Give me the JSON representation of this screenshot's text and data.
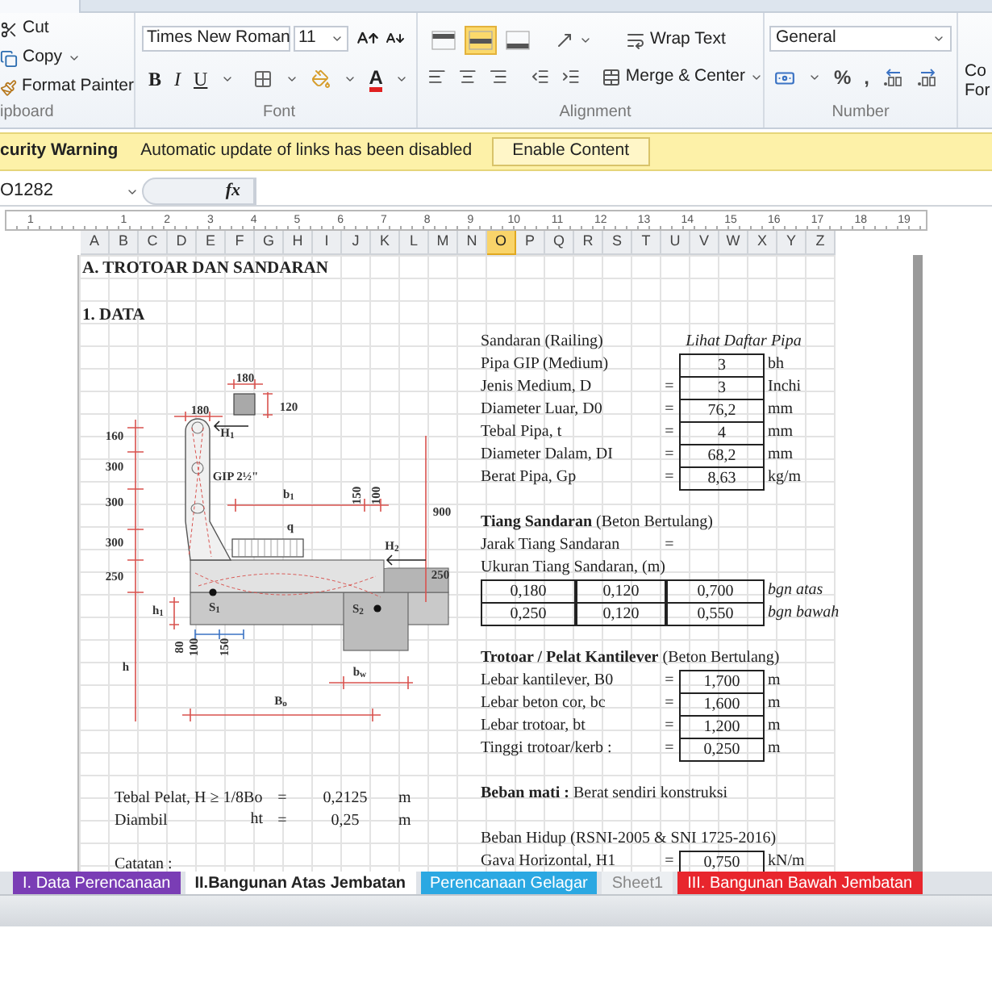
{
  "ribbon": {
    "clipboard": {
      "items": [
        {
          "kind": "cut",
          "label": "Cut"
        },
        {
          "kind": "copy",
          "label": "Copy"
        },
        {
          "kind": "painter",
          "label": "Format Painter"
        }
      ],
      "group_label": "ipboard"
    },
    "font": {
      "family": "Times New Roman",
      "size": "11",
      "styles": [
        "B",
        "I",
        "U"
      ],
      "color_letter": "A",
      "group_label": "Font"
    },
    "alignment": {
      "vertical": [
        {
          "kind": "top",
          "selected": false
        },
        {
          "kind": "middle",
          "selected": true
        },
        {
          "kind": "bottom",
          "selected": false
        }
      ],
      "wrap": "Wrap Text",
      "merge": "Merge & Center",
      "group_label": "Alignment"
    },
    "number": {
      "format": "General",
      "symbols": [
        "%",
        ","
      ],
      "group_label": "Number"
    },
    "styles_cut": [
      "Co",
      "For"
    ]
  },
  "security_bar": {
    "title": "curity Warning",
    "message": "Automatic update of links has been disabled",
    "button": "Enable Content"
  },
  "formula_bar": {
    "name_box": "O1282",
    "fx": "fx"
  },
  "ruler": [
    "1",
    "1",
    "2",
    "3",
    "4",
    "5",
    "6",
    "7",
    "8",
    "9",
    "10",
    "11",
    "12",
    "13",
    "14",
    "15",
    "16",
    "17",
    "18",
    "19"
  ],
  "columns": [
    {
      "label": "A",
      "selected": false
    },
    {
      "label": "B",
      "selected": false
    },
    {
      "label": "C",
      "selected": false
    },
    {
      "label": "D",
      "selected": false
    },
    {
      "label": "E",
      "selected": false
    },
    {
      "label": "F",
      "selected": false
    },
    {
      "label": "G",
      "selected": false
    },
    {
      "label": "H",
      "selected": false
    },
    {
      "label": "I",
      "selected": false
    },
    {
      "label": "J",
      "selected": false
    },
    {
      "label": "K",
      "selected": false
    },
    {
      "label": "L",
      "selected": false
    },
    {
      "label": "M",
      "selected": false
    },
    {
      "label": "N",
      "selected": false
    },
    {
      "label": "O",
      "selected": true
    },
    {
      "label": "P",
      "selected": false
    },
    {
      "label": "Q",
      "selected": false
    },
    {
      "label": "R",
      "selected": false
    },
    {
      "label": "S",
      "selected": false
    },
    {
      "label": "T",
      "selected": false
    },
    {
      "label": "U",
      "selected": false
    },
    {
      "label": "V",
      "selected": false
    },
    {
      "label": "W",
      "selected": false
    },
    {
      "label": "X",
      "selected": false
    },
    {
      "label": "Y",
      "selected": false
    },
    {
      "label": "Z",
      "selected": false
    }
  ],
  "sheet": {
    "title": "A. TROTOAR DAN SANDARAN",
    "section": "1. DATA",
    "drawing": {
      "labels": [
        "180",
        "120",
        "180",
        "H$_{1}$",
        "160",
        "300",
        "300",
        "300",
        "250",
        "GIP 2½\"",
        "b$_{1}$",
        "150",
        "100",
        "900",
        "q",
        "H$_{2}$",
        "250",
        "h$_{1}$",
        "S$_{1}$",
        "S$_{2}$",
        "80",
        "100",
        "150",
        "b$_{w}$",
        "B$_{o}$",
        "h"
      ]
    },
    "left_rows": [
      {
        "label": "Tebal Pelat, H ≥ 1/8Bo",
        "equals": "=",
        "value": "0,2125",
        "unit": "m"
      },
      {
        "label": "Diambil",
        "symbol": "ht",
        "equals": "=",
        "value": "0,25",
        "unit": "m"
      }
    ],
    "note": "Catatan :",
    "right_sections": [
      {
        "rows": [
          {
            "kind": "heading",
            "label": "Sandaran (Railing)",
            "note": "Lihat Daftar Pipa"
          },
          {
            "kind": "value",
            "label": "Pipa GIP (Medium)",
            "value": "3",
            "unit": "bh"
          },
          {
            "kind": "value",
            "label": "Jenis Medium, D",
            "equals": "=",
            "value": "3",
            "unit": "Inchi"
          },
          {
            "kind": "value",
            "label": "Diameter Luar, D0",
            "equals": "=",
            "value": "76,2",
            "unit": "mm"
          },
          {
            "kind": "value",
            "label": "Tebal Pipa, t",
            "equals": "=",
            "value": "4",
            "unit": "mm"
          },
          {
            "kind": "value",
            "label": "Diameter Dalam, DI",
            "equals": "=",
            "value": "68,2",
            "unit": "mm"
          },
          {
            "kind": "value",
            "label": "Berat Pipa, Gp",
            "equals": "=",
            "value": "8,63",
            "unit": "kg/m"
          }
        ]
      },
      {
        "rows": [
          {
            "kind": "text",
            "text": "**Tiang Sandaran** (Beton Bertulang)"
          },
          {
            "kind": "value",
            "label": "Jarak Tiang Sandaran",
            "equals": "="
          },
          {
            "kind": "text",
            "text": "Ukuran Tiang Sandaran, (m)"
          },
          {
            "kind": "sizes",
            "cells": [
              "0,180",
              "0,120",
              "0,700"
            ],
            "note": "bgn atas"
          },
          {
            "kind": "sizes",
            "cells": [
              "0,250",
              "0,120",
              "0,550"
            ],
            "note": "bgn bawah"
          }
        ]
      },
      {
        "rows": [
          {
            "kind": "text",
            "text": "**Trotoar / Pelat Kantilever** (Beton Bertulang)"
          },
          {
            "kind": "value",
            "label": "Lebar kantilever, B0",
            "equals": "=",
            "value": "1,700",
            "unit": "m"
          },
          {
            "kind": "value",
            "label": "Lebar beton cor, bc",
            "equals": "=",
            "value": "1,600",
            "unit": "m"
          },
          {
            "kind": "value",
            "label": "Lebar trotoar, bt",
            "equals": "=",
            "value": "1,200",
            "unit": "m"
          },
          {
            "kind": "value",
            "label": "Tinggi trotoar/kerb :",
            "equals": "=",
            "value": "0,250",
            "unit": "m"
          }
        ]
      },
      {
        "rows": [
          {
            "kind": "text",
            "text": "**Beban mati :** Berat sendiri konstruksi"
          }
        ]
      },
      {
        "rows": [
          {
            "kind": "text",
            "text": "Beban Hidup (RSNI-2005 & SNI 1725-2016)"
          },
          {
            "kind": "value",
            "label": "Gava Horizontal, H1",
            "equals": "=",
            "value": "0,750",
            "unit": "kN/m"
          }
        ]
      }
    ]
  },
  "sheet_tabs": [
    {
      "label": "I. Data Perencanaan",
      "selected": false,
      "color": "#7a3db5"
    },
    {
      "label": "II.Bangunan Atas Jembatan",
      "selected": true
    },
    {
      "label": "Perencanaan Gelagar",
      "selected": false,
      "color": "#2ba8e2"
    },
    {
      "label": "Sheet1",
      "selected": false
    },
    {
      "label": "III. Bangunan Bawah Jembatan",
      "selected": false,
      "color": "#e8262d"
    }
  ]
}
